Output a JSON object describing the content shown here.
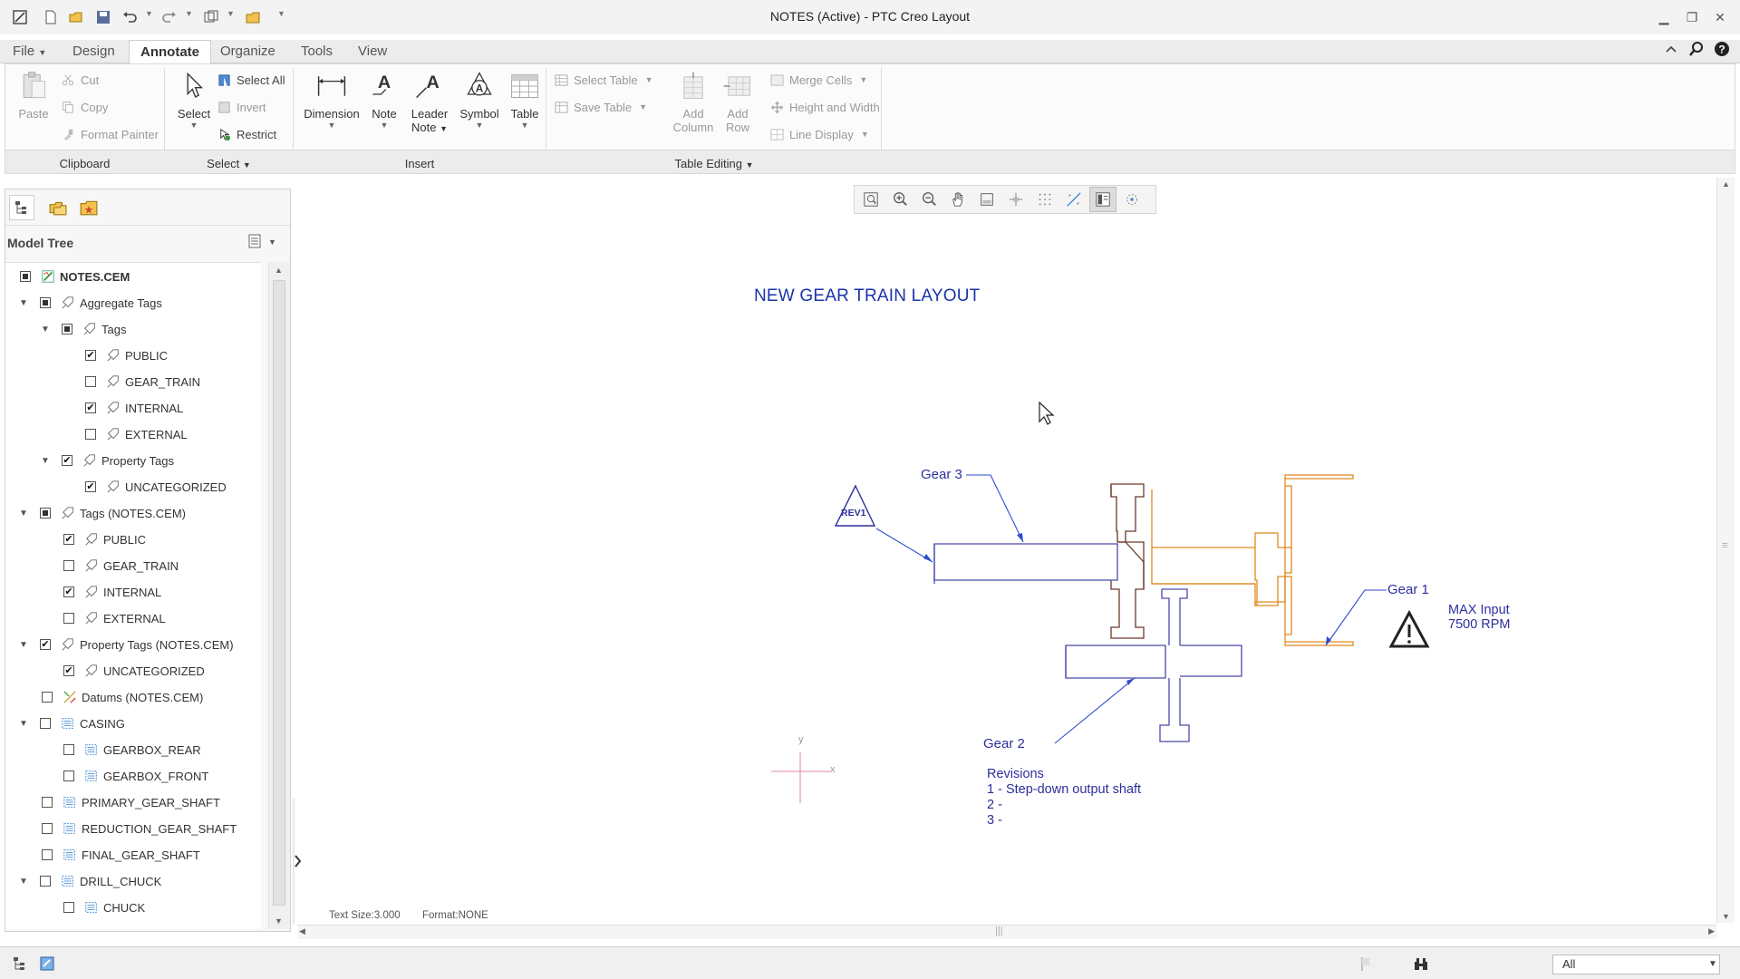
{
  "window": {
    "title": "NOTES (Active) - PTC Creo Layout"
  },
  "tabs": [
    {
      "label": "File"
    },
    {
      "label": "Design"
    },
    {
      "label": "Annotate"
    },
    {
      "label": "Organize"
    },
    {
      "label": "Tools"
    },
    {
      "label": "View"
    }
  ],
  "ribbon": {
    "clipboard": {
      "group_label": "Clipboard",
      "paste": "Paste",
      "cut": "Cut",
      "copy": "Copy",
      "format_painter": "Format Painter"
    },
    "select": {
      "group_label": "Select",
      "select": "Select",
      "select_all": "Select All",
      "invert": "Invert",
      "restrict": "Restrict"
    },
    "insert": {
      "group_label": "Insert",
      "dimension": "Dimension",
      "note": "Note",
      "leader_note_1": "Leader",
      "leader_note_2": "Note",
      "symbol": "Symbol",
      "table": "Table"
    },
    "table_editing": {
      "group_label": "Table Editing",
      "select_table": "Select Table",
      "save_table": "Save Table",
      "add_column_1": "Add",
      "add_column_2": "Column",
      "add_row_1": "Add",
      "add_row_2": "Row",
      "merge_cells": "Merge Cells",
      "height_width": "Height and Width",
      "line_display": "Line Display"
    }
  },
  "model_tree": {
    "title": "Model Tree",
    "nodes": [
      {
        "label": "NOTES.CEM"
      },
      {
        "label": "Aggregate Tags"
      },
      {
        "label": "Tags"
      },
      {
        "label": "PUBLIC"
      },
      {
        "label": "GEAR_TRAIN"
      },
      {
        "label": "INTERNAL"
      },
      {
        "label": "EXTERNAL"
      },
      {
        "label": "Property Tags"
      },
      {
        "label": "UNCATEGORIZED"
      },
      {
        "label": "Tags (NOTES.CEM)"
      },
      {
        "label": "PUBLIC"
      },
      {
        "label": "GEAR_TRAIN"
      },
      {
        "label": "INTERNAL"
      },
      {
        "label": "EXTERNAL"
      },
      {
        "label": "Property Tags (NOTES.CEM)"
      },
      {
        "label": "UNCATEGORIZED"
      },
      {
        "label": "Datums (NOTES.CEM)"
      },
      {
        "label": "CASING"
      },
      {
        "label": "GEARBOX_REAR"
      },
      {
        "label": "GEARBOX_FRONT"
      },
      {
        "label": "PRIMARY_GEAR_SHAFT"
      },
      {
        "label": "REDUCTION_GEAR_SHAFT"
      },
      {
        "label": "FINAL_GEAR_SHAFT"
      },
      {
        "label": "DRILL_CHUCK"
      },
      {
        "label": "CHUCK"
      }
    ]
  },
  "canvas": {
    "drawing_title": "NEW GEAR TRAIN LAYOUT",
    "gear1": "Gear 1",
    "gear2": "Gear 2",
    "gear3": "Gear 3",
    "rev_tag": "REV1",
    "max_input_1": "MAX Input",
    "max_input_2": "7500 RPM",
    "revisions_title": "Revisions",
    "revision_1": "1 - Step-down output shaft",
    "revision_2": "2 -",
    "revision_3": "3 -",
    "axis_x": "x",
    "axis_y": "y",
    "colors": {
      "annotation": "#2d2f9c",
      "title": "#1a33a8",
      "gear1": "#e0891f",
      "gear_shaft": "#6b3a2a",
      "leader": "#2e4bd0"
    }
  },
  "status": {
    "text_size": "Text Size:3.000",
    "format": "Format:NONE",
    "filter": "All"
  }
}
